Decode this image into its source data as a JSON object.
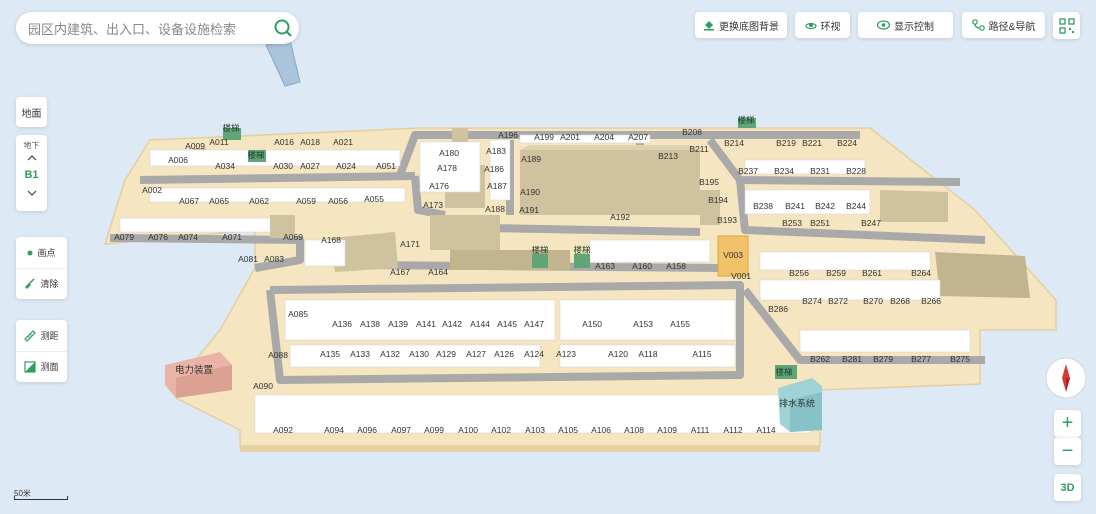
{
  "search": {
    "placeholder": "园区内建筑、出入口、设备设施检索"
  },
  "toolbar": {
    "change_background": "更换底图背景",
    "roam": "环视",
    "display_control": "显示控制",
    "route_nav": "路径&导航"
  },
  "floor": {
    "ground": "地面",
    "underground": "地下",
    "current": "B1"
  },
  "left_tools": {
    "mark": "画点",
    "clear": "清除",
    "measure_distance": "测距",
    "measure_area": "测面"
  },
  "scale": {
    "label": "50米"
  },
  "view": {
    "mode": "3D",
    "zoom_in": "+",
    "zoom_out": "−"
  },
  "map_labels": {
    "stairs": "楼梯",
    "power": "电力装置",
    "drainage": "排水系统",
    "spaces_a": [
      "A002",
      "A006",
      "A009",
      "A011",
      "A016",
      "A018",
      "A021",
      "A027",
      "A024",
      "A030",
      "A034",
      "A051",
      "A055",
      "A056",
      "A059",
      "A062",
      "A065",
      "A067",
      "A069",
      "A071",
      "A074",
      "A076",
      "A079",
      "A081",
      "A083",
      "A085",
      "A088",
      "A090",
      "A092",
      "A094",
      "A096",
      "A097",
      "A099",
      "A100",
      "A102",
      "A103",
      "A105",
      "A106",
      "A108",
      "A109",
      "A111",
      "A112",
      "A114",
      "A115",
      "A118",
      "A120",
      "A123",
      "A124",
      "A126",
      "A127",
      "A129",
      "A130",
      "A132",
      "A133",
      "A135",
      "A136",
      "A138",
      "A139",
      "A141",
      "A142",
      "A144",
      "A145",
      "A147",
      "A150",
      "A153",
      "A155",
      "A158",
      "A160",
      "A163",
      "A164",
      "A167",
      "A168",
      "A171",
      "A173",
      "A176",
      "A178",
      "A180",
      "A183",
      "A186",
      "A187",
      "A188",
      "A189",
      "A190",
      "A191",
      "A192",
      "A196",
      "A199",
      "A201",
      "A204",
      "A207"
    ],
    "spaces_b": [
      "B193",
      "B194",
      "B195",
      "B208",
      "B211",
      "B213",
      "B214",
      "B219",
      "B221",
      "B224",
      "B228",
      "B231",
      "B234",
      "B237",
      "B238",
      "B241",
      "B242",
      "B244",
      "B247",
      "B251",
      "B253",
      "B256",
      "B259",
      "B261",
      "B262",
      "B264",
      "B266",
      "B268",
      "B270",
      "B272",
      "B274",
      "B275",
      "B277",
      "B279",
      "B281",
      "B286"
    ],
    "spaces_v": [
      "V001",
      "V003"
    ]
  },
  "colors": {
    "accent": "#2f9e62",
    "floor": "#f5e5c0",
    "road": "#a9a9a9",
    "building": "#cfc29e",
    "background": "#dde9f4"
  }
}
